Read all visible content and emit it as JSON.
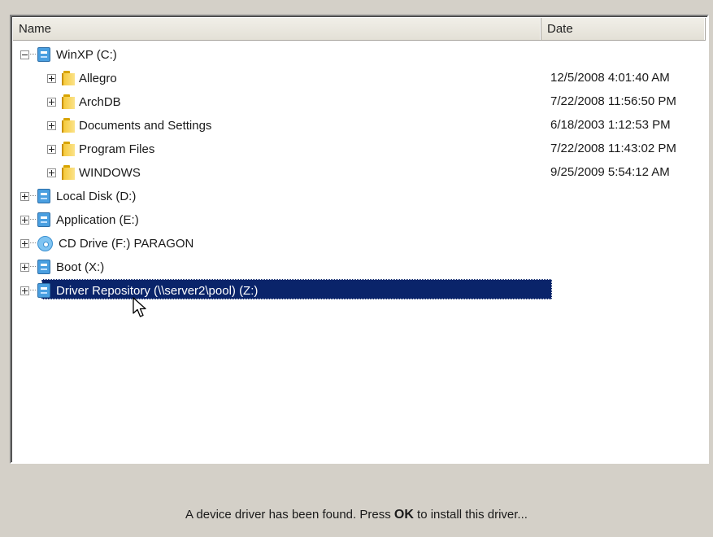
{
  "columns": {
    "name": "Name",
    "date": "Date"
  },
  "tree": [
    {
      "label": "WinXP (C:)",
      "type": "drive",
      "expanded": true,
      "date": ""
    },
    {
      "label": "Allegro",
      "type": "folder",
      "date": "12/5/2008 4:01:40 AM"
    },
    {
      "label": "ArchDB",
      "type": "folder",
      "date": "7/22/2008 11:56:50 PM"
    },
    {
      "label": "Documents and Settings",
      "type": "folder",
      "date": "6/18/2003 1:12:53 PM"
    },
    {
      "label": "Program Files",
      "type": "folder",
      "date": "7/22/2008 11:43:02 PM"
    },
    {
      "label": "WINDOWS",
      "type": "folder",
      "date": "9/25/2009 5:54:12 AM"
    },
    {
      "label": "Local Disk (D:)",
      "type": "drive",
      "date": ""
    },
    {
      "label": "Application (E:)",
      "type": "drive",
      "date": ""
    },
    {
      "label": "CD Drive (F:) PARAGON",
      "type": "cd",
      "date": ""
    },
    {
      "label": "Boot (X:)",
      "type": "drive",
      "date": ""
    },
    {
      "label": "Driver Repository (\\\\server2\\pool) (Z:)",
      "type": "drive",
      "selected": true,
      "date": ""
    }
  ],
  "status": {
    "before": "A device driver has been found. Press ",
    "ok": "OK",
    "after": " to install this driver..."
  },
  "colors": {
    "selection": "#0a246a",
    "panel": "#d4d0c8"
  },
  "icons": {
    "drive": "drive-icon",
    "folder": "folder-icon",
    "cd": "cd-drive-icon",
    "pointer": "mouse-pointer-icon"
  }
}
